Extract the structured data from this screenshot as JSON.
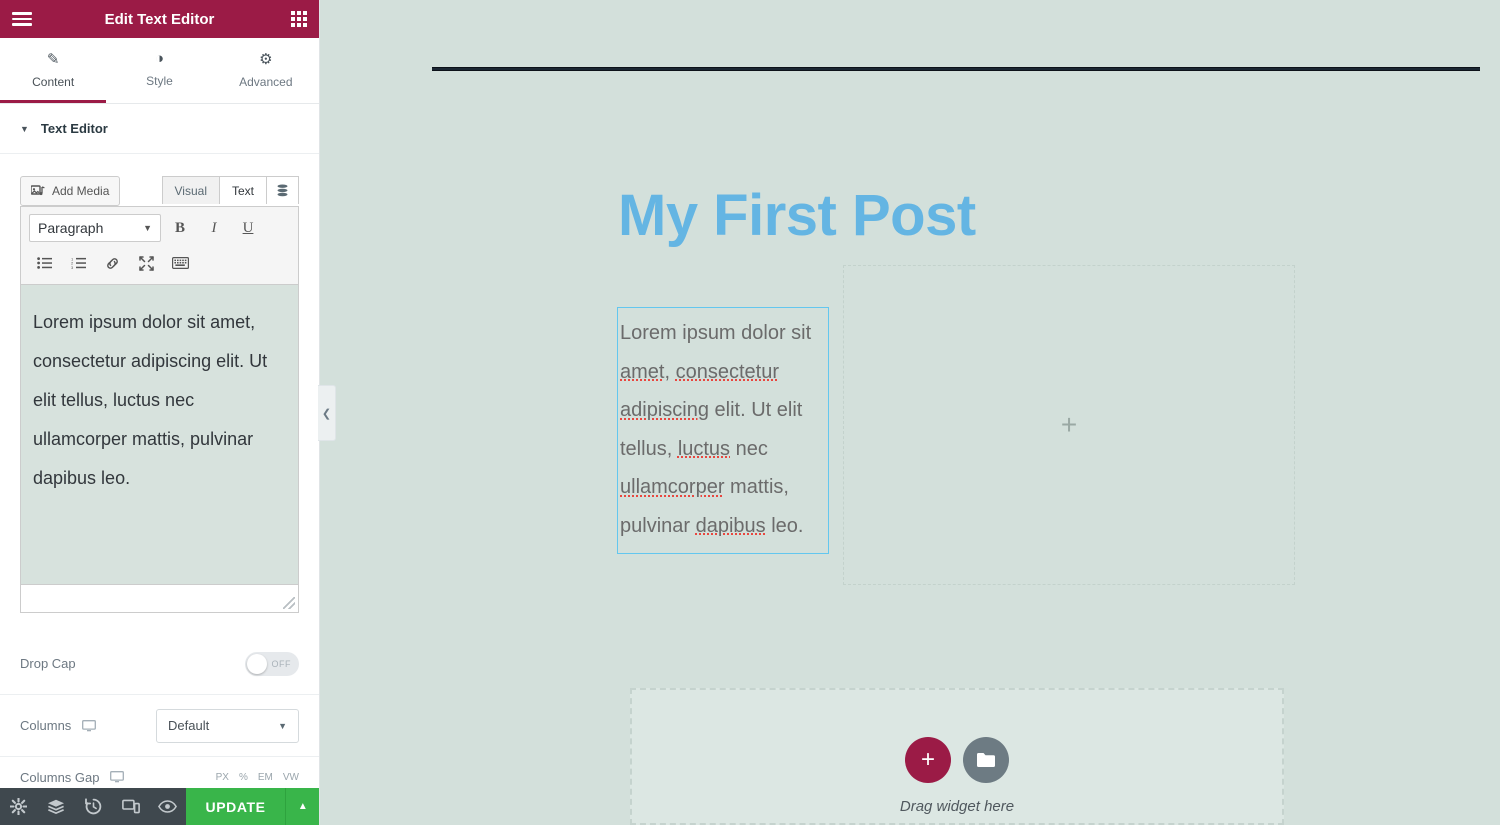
{
  "panel": {
    "header": {
      "title": "Edit Text Editor",
      "menu_icon": "hamburger-menu-icon",
      "apps_icon": "apps-grid-icon"
    },
    "tabs": [
      {
        "label": "Content",
        "icon": "pencil-icon",
        "glyph": "✎",
        "active": true
      },
      {
        "label": "Style",
        "icon": "contrast-circle-icon",
        "glyph": "◑",
        "active": false
      },
      {
        "label": "Advanced",
        "icon": "gear-icon",
        "glyph": "⚙",
        "active": false
      }
    ],
    "section": {
      "title": "Text Editor",
      "caret": "▼"
    },
    "wp_editor": {
      "add_media_label": "Add Media",
      "add_media_icon": "media-photo-music-icon",
      "mode_tabs": [
        {
          "label": "Visual",
          "active": false
        },
        {
          "label": "Text",
          "active": true
        }
      ],
      "toolbar_toggle_icon": "toolbar-toggle-icon",
      "format_select": {
        "value": "Paragraph",
        "caret": "▼"
      },
      "format_buttons": [
        {
          "name": "bold-button",
          "label": "B"
        },
        {
          "name": "italic-button",
          "label": "I"
        },
        {
          "name": "underline-button",
          "label": "U"
        }
      ],
      "row2_buttons": [
        {
          "name": "bulleted-list-button",
          "icon": "bulleted-list-icon"
        },
        {
          "name": "numbered-list-button",
          "icon": "numbered-list-icon"
        },
        {
          "name": "insert-link-button",
          "icon": "link-icon"
        },
        {
          "name": "fullscreen-button",
          "icon": "fullscreen-arrows-icon"
        },
        {
          "name": "keyboard-shortcuts-button",
          "icon": "keyboard-icon"
        }
      ],
      "content": "Lorem ipsum dolor sit amet, consectetur adipiscing elit. Ut elit tellus, luctus nec ullamcorper mattis, pulvinar dapibus leo."
    },
    "controls": {
      "drop_cap": {
        "label": "Drop Cap",
        "state": "OFF"
      },
      "columns": {
        "label": "Columns",
        "device_icon": "desktop-icon",
        "value": "Default",
        "caret": "▼"
      },
      "columns_gap": {
        "label": "Columns Gap",
        "device_icon": "desktop-icon",
        "units": [
          "PX",
          "%",
          "EM",
          "VW"
        ]
      }
    }
  },
  "bottom_bar": {
    "icons": [
      {
        "name": "settings-gear-icon",
        "glyph": "⚙"
      },
      {
        "name": "navigator-layers-icon",
        "glyph": "≣"
      },
      {
        "name": "history-revisions-icon",
        "glyph": "↺"
      },
      {
        "name": "responsive-mode-icon",
        "glyph": "▭"
      },
      {
        "name": "preview-eye-icon",
        "glyph": "◉"
      }
    ],
    "update_label": "UPDATE",
    "update_caret": "▲"
  },
  "canvas": {
    "post_title": "My First Post",
    "text_widget": {
      "segments": [
        {
          "t": "Lorem ipsum dolor sit ",
          "sp": false
        },
        {
          "t": "amet",
          "sp": true
        },
        {
          "t": ", ",
          "sp": false
        },
        {
          "t": "consectetur",
          "sp": true
        },
        {
          "t": " ",
          "sp": false
        },
        {
          "t": "adipiscing",
          "sp": true
        },
        {
          "t": " elit. Ut elit tellus, ",
          "sp": false
        },
        {
          "t": "luctus",
          "sp": true
        },
        {
          "t": " nec ",
          "sp": false
        },
        {
          "t": "ullamcorper",
          "sp": true
        },
        {
          "t": " mattis, pulvinar ",
          "sp": false
        },
        {
          "t": "dapibus",
          "sp": true
        },
        {
          "t": " leo.",
          "sp": false
        }
      ],
      "plain": "Lorem ipsum dolor sit amet, consectetur adipiscing elit. Ut elit tellus, luctus nec ullamcorper mattis, pulvinar dapibus leo."
    },
    "empty_column": {
      "plus_glyph": "+",
      "icon": "plus-icon"
    },
    "drag_area": {
      "label": "Drag widget here",
      "add_button_glyph": "+",
      "add_button_icon": "plus-icon",
      "template_button_icon": "folder-icon",
      "template_button_glyph": "▰"
    },
    "panel_handle": {
      "icon": "chevron-left-icon",
      "glyph": "❮"
    }
  },
  "colors": {
    "brand": "#9b1b46",
    "update": "#39b54a",
    "canvas_bg": "#d3e0db",
    "title": "#64b5e3",
    "selection_border": "#63c7ef",
    "spellcheck": "#e8473f"
  }
}
